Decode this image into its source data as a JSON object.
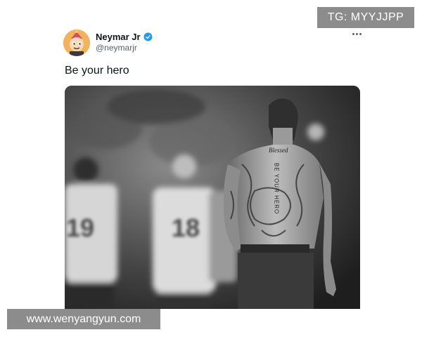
{
  "tweet": {
    "author_name": "Neymar Jr",
    "author_handle": "@neymarjr",
    "verified": true,
    "avatar_icon": "cartoon-avatar-icon",
    "more_icon": "more-options-icon",
    "text": "Be your hero",
    "media": {
      "description_icon": "photo-image",
      "jersey_numbers": [
        "19",
        "18"
      ],
      "tattoo_text": "BE YOUR HERO"
    }
  },
  "watermarks": {
    "top_right": "TG: MYYJJPP",
    "bottom_left": "www.wenyangyun.com"
  },
  "colors": {
    "text_primary": "#0f1419",
    "text_secondary": "#536471",
    "verified_blue": "#1d9bf0",
    "watermark_bg": "#8c8c8c"
  }
}
